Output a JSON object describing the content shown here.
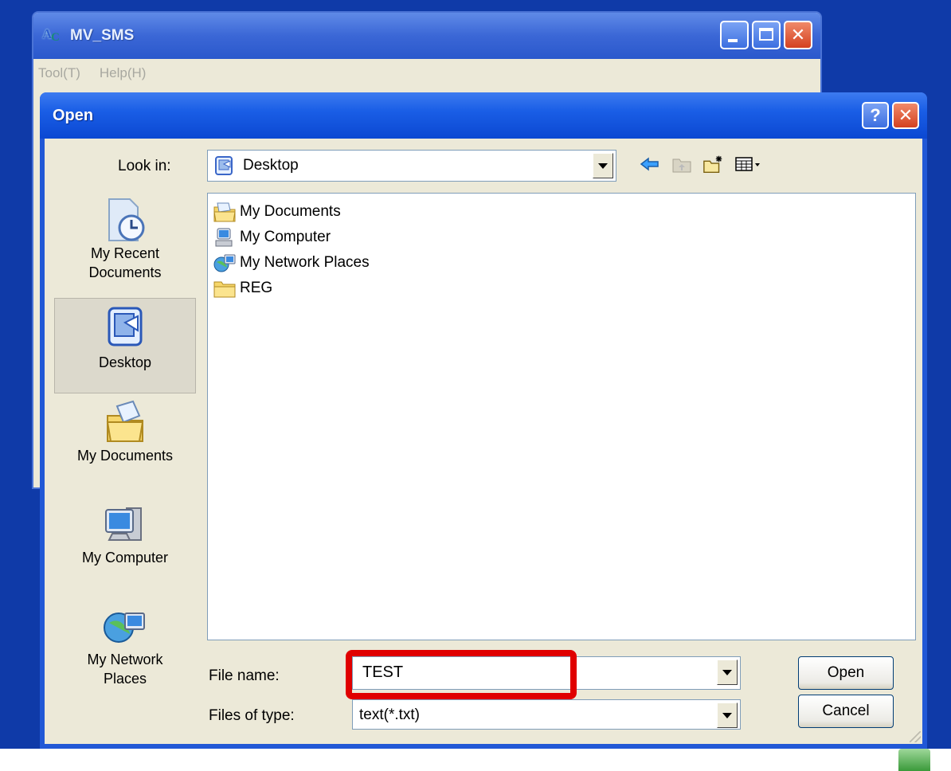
{
  "background_app": {
    "title": "MV_SMS",
    "menu": [
      "Tool(T)",
      "Help(H)"
    ]
  },
  "dialog": {
    "title": "Open",
    "look_in": {
      "label": "Look in:",
      "value": "Desktop"
    },
    "places": [
      {
        "label_line1": "My Recent",
        "label_line2": "Documents",
        "icon": "recent-documents-icon"
      },
      {
        "label_line1": "Desktop",
        "label_line2": "",
        "icon": "desktop-icon",
        "selected": true
      },
      {
        "label_line1": "My Documents",
        "label_line2": "",
        "icon": "my-documents-icon"
      },
      {
        "label_line1": "My Computer",
        "label_line2": "",
        "icon": "my-computer-icon"
      },
      {
        "label_line1": "My Network",
        "label_line2": "Places",
        "icon": "network-places-icon"
      }
    ],
    "files": [
      {
        "name": "My Documents",
        "icon": "my-documents-icon"
      },
      {
        "name": "My Computer",
        "icon": "my-computer-icon"
      },
      {
        "name": "My Network Places",
        "icon": "network-places-icon"
      },
      {
        "name": "REG",
        "icon": "folder-icon"
      }
    ],
    "file_name": {
      "label": "File name:",
      "value": "TEST"
    },
    "file_type": {
      "label": "Files of type:",
      "value": "text(*.txt)"
    },
    "buttons": {
      "open": "Open",
      "cancel": "Cancel"
    }
  },
  "colors": {
    "highlight": "#e00000",
    "titlebar": "#1a5ee6"
  }
}
